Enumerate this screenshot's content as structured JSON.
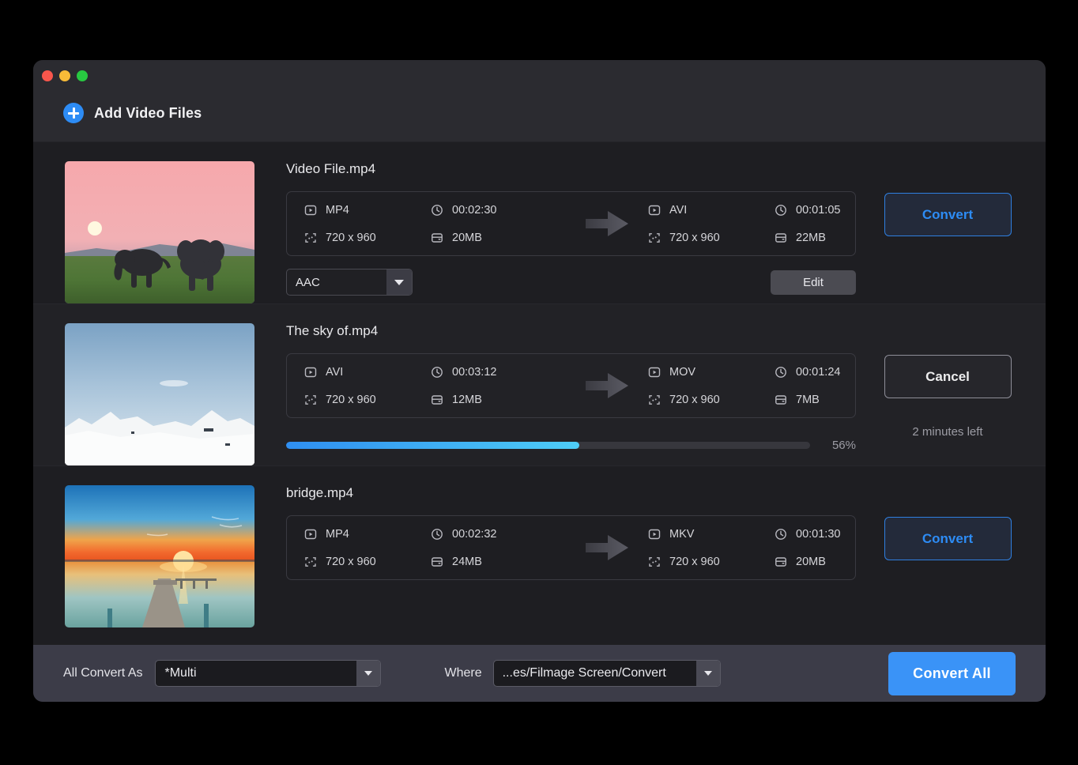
{
  "window": {
    "traffic_lights": [
      "close",
      "minimize",
      "maximize"
    ],
    "add_files_label": "Add Video Files"
  },
  "files": [
    {
      "name": "Video File.mp4",
      "thumbnail": "elephants-sunset-thumbnail",
      "source": {
        "format": "MP4",
        "duration": "00:02:30",
        "resolution": "720 x 960",
        "size": "20MB"
      },
      "target": {
        "format": "AVI",
        "duration": "00:01:05",
        "resolution": "720 x 960",
        "size": "22MB"
      },
      "audio_codec": "AAC",
      "edit_label": "Edit",
      "action_label": "Convert",
      "action_type": "convert"
    },
    {
      "name": "The sky of.mp4",
      "thumbnail": "snow-mountains-thumbnail",
      "source": {
        "format": "AVI",
        "duration": "00:03:12",
        "resolution": "720 x 960",
        "size": "12MB"
      },
      "target": {
        "format": "MOV",
        "duration": "00:01:24",
        "resolution": "720 x 960",
        "size": "7MB"
      },
      "progress_percent": 56,
      "progress_label": "56%",
      "eta": "2 minutes left",
      "action_label": "Cancel",
      "action_type": "cancel"
    },
    {
      "name": "bridge.mp4",
      "thumbnail": "pier-sunset-thumbnail",
      "source": {
        "format": "MP4",
        "duration": "00:02:32",
        "resolution": "720 x 960",
        "size": "24MB"
      },
      "target": {
        "format": "MKV",
        "duration": "00:01:30",
        "resolution": "720 x 960",
        "size": "20MB"
      },
      "action_label": "Convert",
      "action_type": "convert"
    }
  ],
  "bottom_bar": {
    "convert_as_label": "All Convert As",
    "convert_as_value": "*Multi",
    "where_label": "Where",
    "where_value": "...es/Filmage Screen/Convert",
    "convert_all_label": "Convert  All"
  },
  "colors": {
    "accent_blue": "#2d8cf5",
    "convert_all_blue": "#3a93f7",
    "progress_start": "#2f8ef0",
    "progress_end": "#4ecdf7",
    "window_bg": "#1e1e22",
    "titlebar_bg": "#2b2b30",
    "bottombar_bg": "#3c3c48"
  }
}
